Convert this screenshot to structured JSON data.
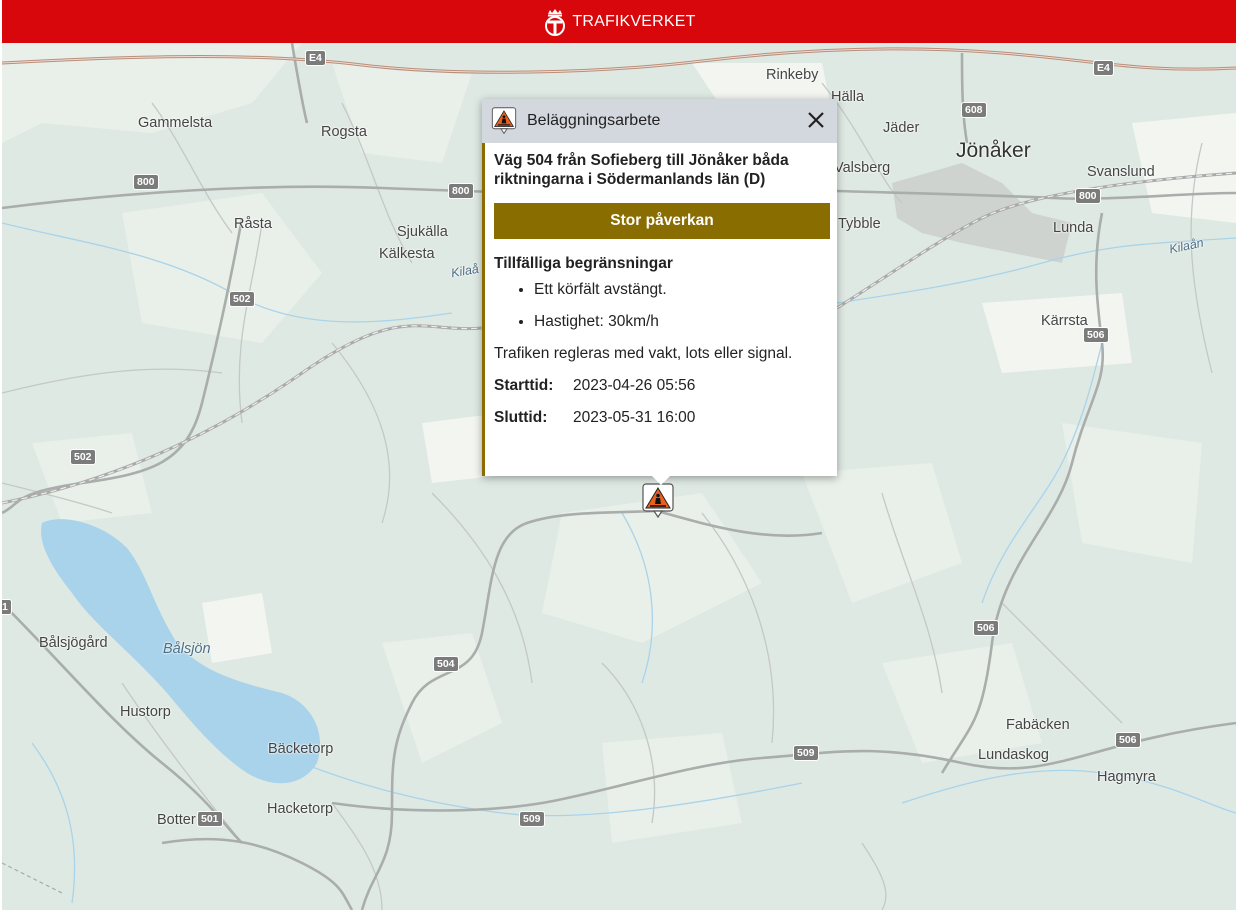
{
  "header": {
    "brand": "TRAFIKVERKET",
    "logo_icon": "trafikverket-crown-logo-icon",
    "background": "#d8070b"
  },
  "map": {
    "places": [
      {
        "name": "Rinkeby"
      },
      {
        "name": "Hälla"
      },
      {
        "name": "Jäder"
      },
      {
        "name": "Jönåker"
      },
      {
        "name": "Svanslund"
      },
      {
        "name": "Valsberg"
      },
      {
        "name": "Tybble"
      },
      {
        "name": "Lunda"
      },
      {
        "name": "Kilaån"
      },
      {
        "name": "Kärrsta"
      },
      {
        "name": "Gammelsta"
      },
      {
        "name": "Rogsta"
      },
      {
        "name": "Råsta"
      },
      {
        "name": "Sjukälla"
      },
      {
        "name": "Kälkesta"
      },
      {
        "name": "Kilaå"
      },
      {
        "name": "Bålsjögård"
      },
      {
        "name": "Bålsjön"
      },
      {
        "name": "Hustorp"
      },
      {
        "name": "Bäcketorp"
      },
      {
        "name": "Hacketorp"
      },
      {
        "name": "Botter"
      },
      {
        "name": "Fabäcken"
      },
      {
        "name": "Lundaskog"
      },
      {
        "name": "Hagmyra"
      }
    ],
    "road_shields": [
      {
        "label": "E4"
      },
      {
        "label": "E4"
      },
      {
        "label": "608"
      },
      {
        "label": "800"
      },
      {
        "label": "800"
      },
      {
        "label": "800"
      },
      {
        "label": "502"
      },
      {
        "label": "502"
      },
      {
        "label": "506"
      },
      {
        "label": "506"
      },
      {
        "label": "506"
      },
      {
        "label": "504"
      },
      {
        "label": "509"
      },
      {
        "label": "509"
      },
      {
        "label": "501"
      },
      {
        "label": "1"
      }
    ],
    "marker_icon": "roadwork-warning-icon"
  },
  "popup": {
    "title": "Beläggningsarbete",
    "title_icon": "roadwork-warning-icon",
    "close_icon": "close-icon",
    "road": "Väg 504 från Sofieberg till Jönåker båda riktningarna i Södermanlands län (D)",
    "impact": "Stor påverkan",
    "impact_color": "#8a6d00",
    "restrictions_title": "Tillfälliga begränsningar",
    "restrictions": [
      "Ett körfält avstängt.",
      "Hastighet: 30km/h"
    ],
    "traffic_note": "Trafiken regleras med vakt, lots eller signal.",
    "start_label": "Starttid:",
    "start_value": "2023-04-26 05:56",
    "end_label": "Sluttid:",
    "end_value": "2023-05-31 16:00"
  }
}
